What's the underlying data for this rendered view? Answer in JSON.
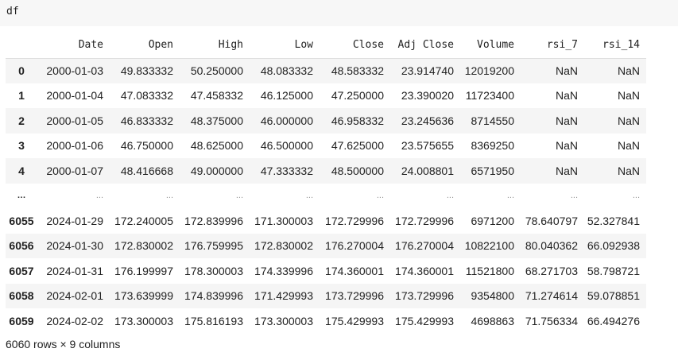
{
  "cell": {
    "code": "df"
  },
  "table": {
    "columns": [
      "",
      "Date",
      "Open",
      "High",
      "Low",
      "Close",
      "Adj Close",
      "Volume",
      "rsi_7",
      "rsi_14"
    ],
    "rows": [
      [
        "0",
        "2000-01-03",
        "49.833332",
        "50.250000",
        "48.083332",
        "48.583332",
        "23.914740",
        "12019200",
        "NaN",
        "NaN"
      ],
      [
        "1",
        "2000-01-04",
        "47.083332",
        "47.458332",
        "46.125000",
        "47.250000",
        "23.390020",
        "11723400",
        "NaN",
        "NaN"
      ],
      [
        "2",
        "2000-01-05",
        "46.833332",
        "48.375000",
        "46.000000",
        "46.958332",
        "23.245636",
        "8714550",
        "NaN",
        "NaN"
      ],
      [
        "3",
        "2000-01-06",
        "46.750000",
        "48.625000",
        "46.500000",
        "47.625000",
        "23.575655",
        "8369250",
        "NaN",
        "NaN"
      ],
      [
        "4",
        "2000-01-07",
        "48.416668",
        "49.000000",
        "47.333332",
        "48.500000",
        "24.008801",
        "6571950",
        "NaN",
        "NaN"
      ],
      [
        "...",
        "...",
        "...",
        "...",
        "...",
        "...",
        "...",
        "...",
        "...",
        "..."
      ],
      [
        "6055",
        "2024-01-29",
        "172.240005",
        "172.839996",
        "171.300003",
        "172.729996",
        "172.729996",
        "6971200",
        "78.640797",
        "52.327841"
      ],
      [
        "6056",
        "2024-01-30",
        "172.830002",
        "176.759995",
        "172.830002",
        "176.270004",
        "176.270004",
        "10822100",
        "80.040362",
        "66.092938"
      ],
      [
        "6057",
        "2024-01-31",
        "176.199997",
        "178.300003",
        "174.339996",
        "174.360001",
        "174.360001",
        "11521800",
        "68.271703",
        "58.798721"
      ],
      [
        "6058",
        "2024-02-01",
        "173.639999",
        "174.839996",
        "171.429993",
        "173.729996",
        "173.729996",
        "9354800",
        "71.274614",
        "59.078851"
      ],
      [
        "6059",
        "2024-02-02",
        "173.300003",
        "175.816193",
        "173.300003",
        "175.429993",
        "175.429993",
        "4698863",
        "71.756334",
        "66.494276"
      ]
    ]
  },
  "footer": {
    "shape": "6060 rows × 9 columns"
  }
}
